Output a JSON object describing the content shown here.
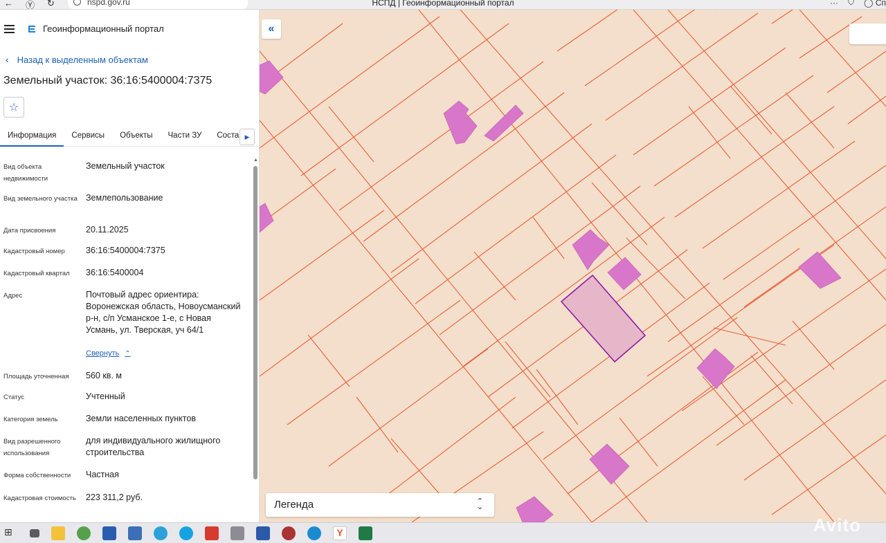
{
  "browser": {
    "url": "nspd.gov.ru",
    "tab_title": "НСПД | Геоинформационный портал",
    "right_text": "Сп"
  },
  "header": {
    "app_title": "Геоинформационный портал"
  },
  "back_link": "Назад к выделенным объектам",
  "object_title": "Земельный участок: 36:16:5400004:7375",
  "tabs": [
    {
      "label": "Информация",
      "active": true
    },
    {
      "label": "Сервисы"
    },
    {
      "label": "Объекты"
    },
    {
      "label": "Части ЗУ"
    },
    {
      "label": "Состав"
    }
  ],
  "fields": [
    {
      "label": "Вид объекта недвижимости",
      "value": "Земельный участок"
    },
    {
      "label": "Вид земельного участка",
      "value": "Землепользование"
    },
    {
      "label": "Дата присвоения",
      "value": "20.11.2025"
    },
    {
      "label": "Кадастровый номер",
      "value": "36:16:5400004:7375"
    },
    {
      "label": "Кадастровый квартал",
      "value": "36:16:5400004"
    },
    {
      "label": "Адрес",
      "value": "Почтовый адрес ориентира: Воронежская область, Новоусманский р-н, с/п Усманское 1-е, с Новая Усмань, ул. Тверская, уч 64/1"
    },
    {
      "label": "Площадь уточненная",
      "value": "560 кв. м"
    },
    {
      "label": "Статус",
      "value": "Учтенный"
    },
    {
      "label": "Категория земель",
      "value": "Земли населенных пунктов"
    },
    {
      "label": "Вид разрешенного использования",
      "value": "для индивидуального жилищного строительства"
    },
    {
      "label": "Форма собственности",
      "value": "Частная"
    },
    {
      "label": "Кадастровая стоимость",
      "value": "223 311,2 руб."
    }
  ],
  "collapse_label": "Свернуть",
  "legend_label": "Легенда",
  "watermark": "Avito",
  "colors": {
    "map_bg": "#f3dfcb",
    "parcel_line": "#e8603a",
    "building": "#d877c9",
    "selected_fill": "#e6b7c8",
    "selected_stroke": "#8e1ba8",
    "accent": "#1d5fb5"
  },
  "taskbar_icons": [
    "start-icon",
    "task-view-icon",
    "file-explorer-icon",
    "chrome-icon",
    "store-icon",
    "calculator-icon",
    "telegram-icon",
    "skype-icon",
    "yandex-disk-icon",
    "printer-icon",
    "word-icon",
    "app-icon",
    "edge-icon",
    "yandex-browser-icon",
    "excel-icon"
  ]
}
